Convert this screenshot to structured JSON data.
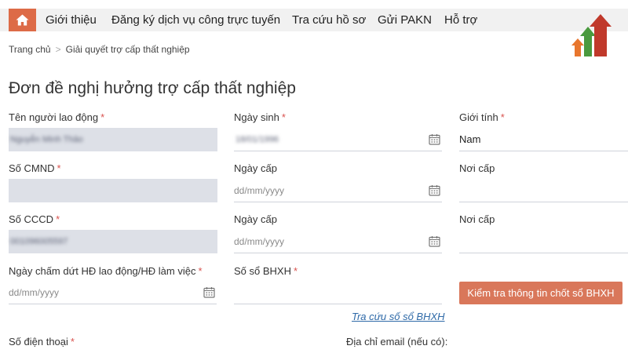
{
  "nav": {
    "items": [
      "Giới thiệu",
      "Đăng ký dịch vụ công trực tuyến",
      "Tra cứu hồ sơ",
      "Gửi PAKN",
      "Hỗ trợ"
    ],
    "home_icon": "home-icon",
    "accent": "#dd6b47"
  },
  "breadcrumb": {
    "home": "Trang chủ",
    "separator": ">",
    "current": "Giải quyết trợ cấp thất nghiệp"
  },
  "form": {
    "title": "Đơn đề nghị hưởng trợ cấp thất nghiệp",
    "required_mark": "*",
    "worker_name": {
      "label": "Tên người lao động",
      "value": "Nguyễn Minh Thảo"
    },
    "dob": {
      "label": "Ngày sinh",
      "value": "18/01/1996"
    },
    "gender": {
      "label": "Giới tính",
      "value": "Nam"
    },
    "cmnd": {
      "label": "Số CMND",
      "value": ""
    },
    "cmnd_issue_date": {
      "label": "Ngày cấp",
      "placeholder": "dd/mm/yyyy"
    },
    "cmnd_issue_place": {
      "label": "Nơi cấp",
      "value": ""
    },
    "cccd": {
      "label": "Số CCCD",
      "value": "001096005597"
    },
    "cccd_issue_date": {
      "label": "Ngày cấp",
      "placeholder": "dd/mm/yyyy"
    },
    "cccd_issue_place": {
      "label": "Nơi cấp",
      "value": ""
    },
    "termination_date": {
      "label": "Ngày chấm dứt HĐ lao động/HĐ làm việc",
      "placeholder": "dd/mm/yyyy"
    },
    "bhxh_number": {
      "label": "Số sổ BHXH",
      "value": ""
    },
    "check_button": "Kiểm tra thông tin chốt sổ BHXH",
    "lookup_link": "Tra cứu số sổ BHXH",
    "phone": {
      "label": "Số điện thoại"
    },
    "email": {
      "label": "Địa chỉ email (nếu có):"
    }
  }
}
